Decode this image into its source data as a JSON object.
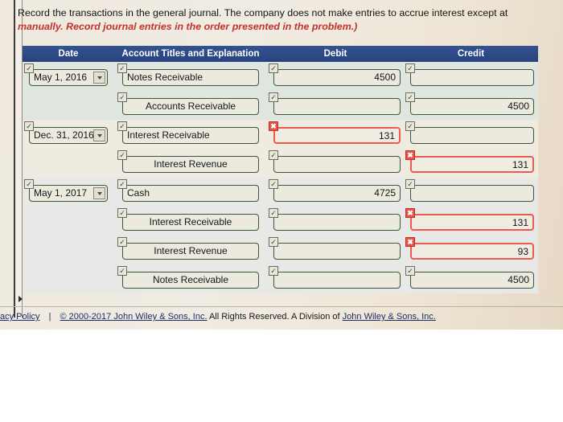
{
  "instructions": {
    "line1": "Record the transactions in the general journal. The company does not make entries to accrue interest except at",
    "line2": "manually. Record journal entries in the order presented in the problem.)"
  },
  "table": {
    "headers": {
      "date": "Date",
      "account": "Account Titles and Explanation",
      "debit": "Debit",
      "credit": "Credit"
    },
    "rows": [
      {
        "date": "May 1, 2016",
        "date_status": "ok",
        "account": "Notes Receivable",
        "account_status": "ok",
        "account_indent": false,
        "debit": "4500",
        "debit_status": "ok",
        "credit": "",
        "credit_status": "ok"
      },
      {
        "date": "",
        "date_status": "none",
        "account": "Accounts Receivable",
        "account_status": "ok",
        "account_indent": true,
        "debit": "",
        "debit_status": "ok",
        "credit": "4500",
        "credit_status": "ok"
      },
      {
        "date": "Dec. 31, 2016",
        "date_status": "ok",
        "account": "Interest Receivable",
        "account_status": "ok",
        "account_indent": false,
        "debit": "131",
        "debit_status": "error",
        "credit": "",
        "credit_status": "ok"
      },
      {
        "date": "",
        "date_status": "none",
        "account": "Interest Revenue",
        "account_status": "ok",
        "account_indent": true,
        "debit": "",
        "debit_status": "ok",
        "credit": "131",
        "credit_status": "error"
      },
      {
        "date": "May 1, 2017",
        "date_status": "ok",
        "account": "Cash",
        "account_status": "ok",
        "account_indent": false,
        "debit": "4725",
        "debit_status": "ok",
        "credit": "",
        "credit_status": "ok"
      },
      {
        "date": "",
        "date_status": "none",
        "account": "Interest Receivable",
        "account_status": "ok",
        "account_indent": true,
        "debit": "",
        "debit_status": "ok",
        "credit": "131",
        "credit_status": "error"
      },
      {
        "date": "",
        "date_status": "none",
        "account": "Interest Revenue",
        "account_status": "ok",
        "account_indent": true,
        "debit": "",
        "debit_status": "ok",
        "credit": "93",
        "credit_status": "error"
      },
      {
        "date": "",
        "date_status": "none",
        "account": "Notes Receivable",
        "account_status": "ok",
        "account_indent": true,
        "debit": "",
        "debit_status": "ok",
        "credit": "4500",
        "credit_status": "ok"
      }
    ]
  },
  "icons": {
    "valid_check": "✓",
    "invalid_cross": "✖",
    "dropdown_caret": "chevron-down-icon"
  },
  "footer": {
    "privacy_link": "acy Policy",
    "separator": "|",
    "copyright_link": "© 2000-2017 John Wiley & Sons, Inc.",
    "rights_text": "All Rights Reserved. A Division of",
    "division_link": "John Wiley & Sons, Inc."
  },
  "colors": {
    "header_blue": "#2b4a8b",
    "error_red": "#ec5a50",
    "valid_green": "#3d5637",
    "instruction_red": "#c6302b"
  }
}
